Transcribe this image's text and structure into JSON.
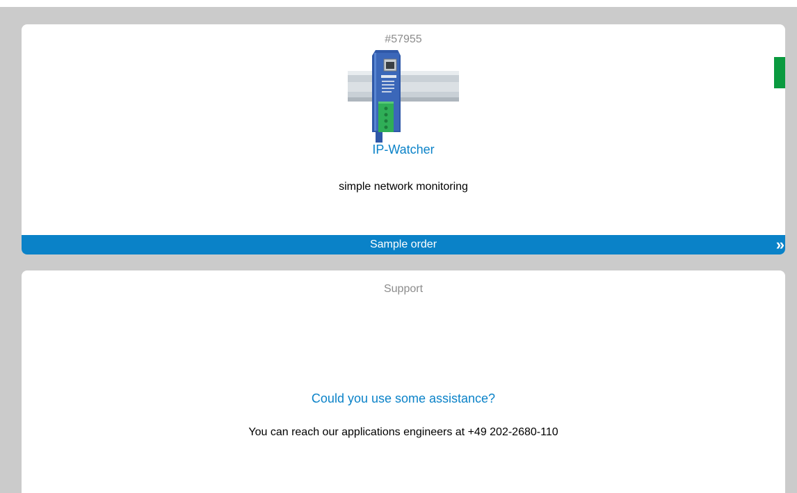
{
  "product": {
    "number": "#57955",
    "name": "IP-Watcher",
    "description": "simple network monitoring",
    "image_icon": "din-rail-device-image"
  },
  "order": {
    "label": "Sample order",
    "chevron": "»"
  },
  "support": {
    "title": "Support",
    "question": "Could you use some assistance?",
    "contact": "You can reach our applications engineers at +49 202-2680-110"
  },
  "colors": {
    "accent": "#0a82c8",
    "marker": "#0a9a3f",
    "background": "#cbcbcb",
    "muted_text": "#8c8c8c"
  }
}
